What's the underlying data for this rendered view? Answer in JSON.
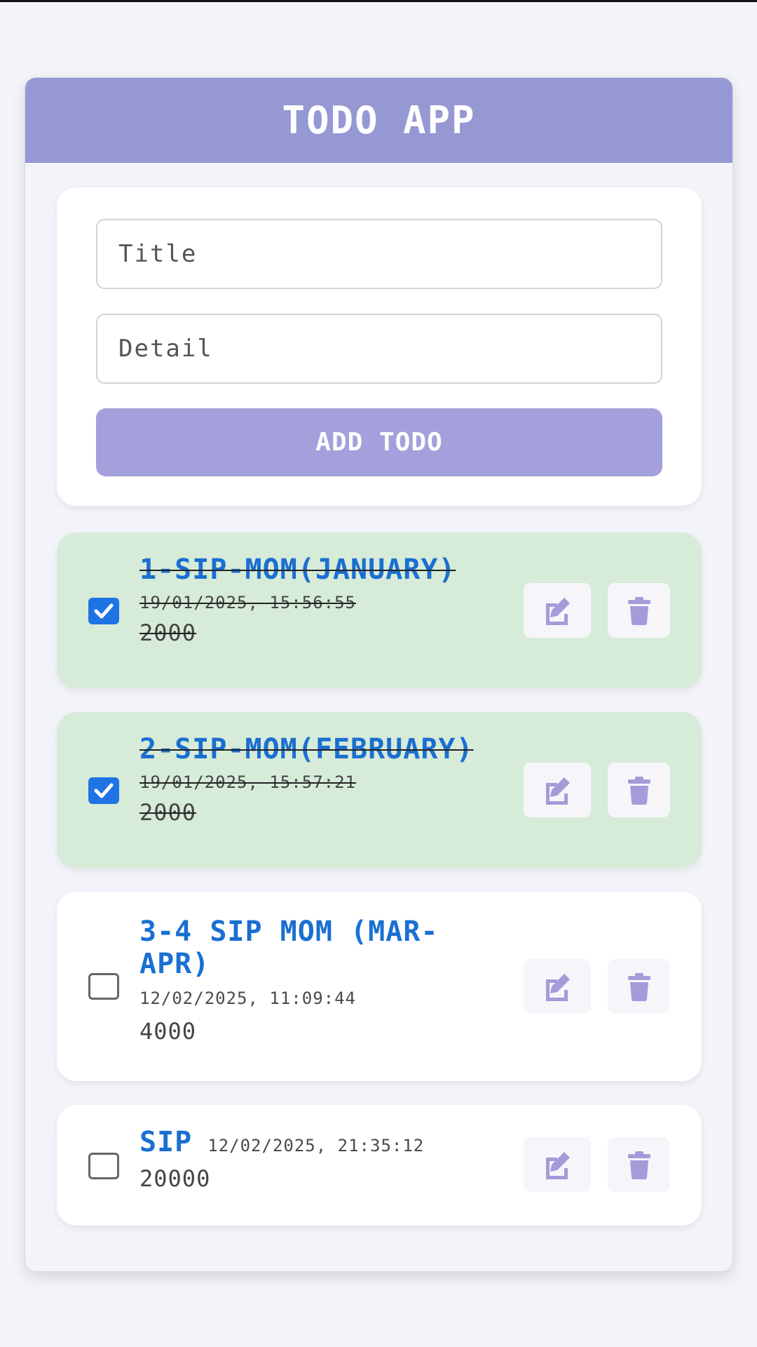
{
  "app": {
    "title": "TODO APP"
  },
  "form": {
    "title_placeholder": "Title",
    "detail_placeholder": "Detail",
    "add_label": "ADD TODO"
  },
  "todos": [
    {
      "title": "1-SIP-MOM(JANUARY)",
      "date": "19/01/2025, 15:56:55",
      "detail": "2000",
      "completed": true
    },
    {
      "title": "2-SIP-MOM(FEBRUARY)",
      "date": "19/01/2025, 15:57:21",
      "detail": "2000",
      "completed": true
    },
    {
      "title": "3-4 SIP MOM (MAR-APR)",
      "date": "12/02/2025, 11:09:44",
      "detail": "4000",
      "completed": false
    },
    {
      "title": "SIP",
      "date": "12/02/2025, 21:35:12",
      "detail": "20000",
      "completed": false
    }
  ],
  "icons": {
    "edit": "edit-icon",
    "delete": "trash-icon",
    "check": "checkmark-icon"
  },
  "colors": {
    "accent": "#9598d3",
    "button": "#a3a0db",
    "completed_bg": "#d6ebd8",
    "title_blue": "#1a6fd1",
    "checkbox_blue": "#1f74e4"
  }
}
